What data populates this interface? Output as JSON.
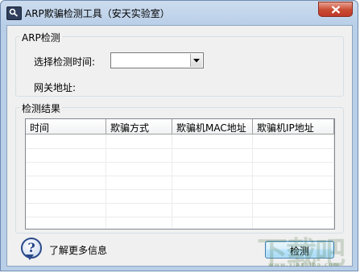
{
  "window": {
    "title": "ARP欺骗检测工具（安天实验室）"
  },
  "arp_group": {
    "legend": "ARP检测",
    "time_label": "选择检测时间:",
    "time_value": "",
    "gateway_label": "网关地址:",
    "gateway_value": ""
  },
  "result_group": {
    "legend": "检测结果",
    "columns": [
      "时间",
      "欺骗方式",
      "欺骗机MAC地址",
      "欺骗机IP地址"
    ],
    "rows": []
  },
  "footer": {
    "more_info": "了解更多信息",
    "detect_button": "检测"
  },
  "watermark": {
    "text": "下载吧",
    "site": "www.xiazaiba.com"
  },
  "icons": {
    "app": "magnifier-icon",
    "close": "close-icon",
    "help": "help-question-icon",
    "dropdown": "chevron-down-icon"
  }
}
